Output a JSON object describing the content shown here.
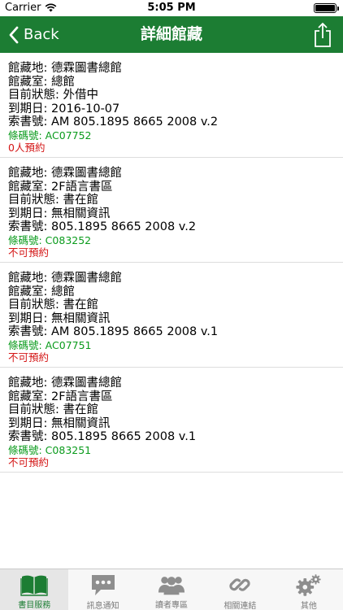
{
  "status_bar": {
    "carrier": "Carrier",
    "time": "5:05 PM",
    "battery_level": 1.0
  },
  "navbar": {
    "back_label": "Back",
    "title": "詳細館藏",
    "share_icon": "share-icon",
    "color": "#1c7d33"
  },
  "records": [
    {
      "location": "館藏地:  德霖圖書總館",
      "room": "館藏室:  總館",
      "status": "目前狀態:  外借中",
      "due": "到期日:    2016-10-07",
      "call_number": "索書號:  AM 805.1895 8665 2008 v.2",
      "barcode": "條碼號:  AC07752",
      "reserve": "0人預約"
    },
    {
      "location": "館藏地:  德霖圖書總館",
      "room": "館藏室:  2F語言書區",
      "status": "目前狀態:   書在館",
      "due": "到期日:  無相關資訊",
      "call_number": "索書號:    805.1895 8665 2008 v.2",
      "barcode": "條碼號:  C083252",
      "reserve": "不可預約"
    },
    {
      "location": "館藏地:  德霖圖書總館",
      "room": "館藏室:  總館",
      "status": "目前狀態:   書在館",
      "due": "到期日:  無相關資訊",
      "call_number": "索書號:  AM 805.1895 8665 2008 v.1",
      "barcode": "條碼號:  AC07751",
      "reserve": "不可預約"
    },
    {
      "location": "館藏地:  德霖圖書總館",
      "room": "館藏室:  2F語言書區",
      "status": "目前狀態:   書在館",
      "due": "到期日:  無相關資訊",
      "call_number": "索書號:    805.1895 8665 2008 v.1",
      "barcode": "條碼號:  C083251",
      "reserve": "不可預約"
    }
  ],
  "tabs": [
    {
      "label": "書目服務",
      "icon": "book-icon",
      "active": true
    },
    {
      "label": "訊息通知",
      "icon": "chat-bubble-icon",
      "active": false
    },
    {
      "label": "讀者專區",
      "icon": "users-icon",
      "active": false
    },
    {
      "label": "相關連結",
      "icon": "link-icon",
      "active": false
    },
    {
      "label": "其他",
      "icon": "gear-icon",
      "active": false
    }
  ],
  "colors": {
    "brand_green": "#1c7d33",
    "barcode_green": "#0a9b1c",
    "reserve_red": "#d41616"
  }
}
